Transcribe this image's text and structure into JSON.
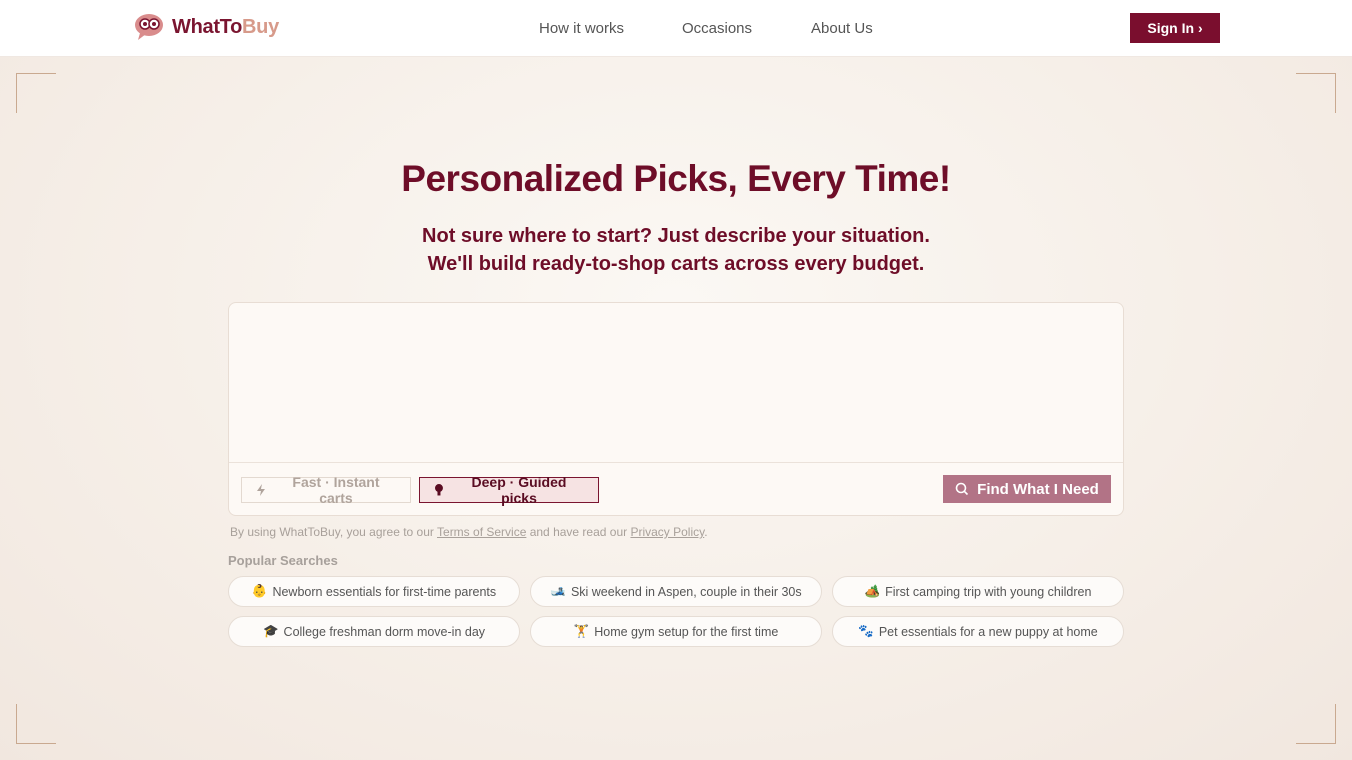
{
  "brand": {
    "what": "WhatTo",
    "buy": "Buy"
  },
  "nav": {
    "how": "How it works",
    "occasions": "Occasions",
    "about": "About Us"
  },
  "signin_label": "Sign In ›",
  "hero": {
    "title": "Personalized Picks, Every Time!",
    "subtitle_line1": "Not sure where to start? Just describe your situation.",
    "subtitle_line2": "We'll build ready-to-shop carts across every budget."
  },
  "search": {
    "placeholder": "",
    "mode_fast": "Fast · Instant carts",
    "mode_deep": "Deep · Guided picks",
    "selected_mode": "deep",
    "find_label": "Find What I Need"
  },
  "legal": {
    "prefix": "By using WhatToBuy, you agree to our ",
    "terms": "Terms of Service",
    "middle": " and have read our ",
    "privacy": "Privacy Policy",
    "suffix": "."
  },
  "popular": {
    "label": "Popular Searches",
    "items": [
      {
        "emoji": "👶",
        "text": "Newborn essentials for first-time parents"
      },
      {
        "emoji": "🎿",
        "text": "Ski weekend in Aspen, couple in their 30s"
      },
      {
        "emoji": "🏕️",
        "text": "First camping trip with young children"
      },
      {
        "emoji": "🎓",
        "text": "College freshman dorm move-in day"
      },
      {
        "emoji": "🏋️",
        "text": "Home gym setup for the first time"
      },
      {
        "emoji": "🐾",
        "text": "Pet essentials for a new puppy at home"
      }
    ]
  },
  "colors": {
    "brand": "#7a0e2e",
    "accent": "#d79a8a",
    "find_button": "#b27386"
  }
}
